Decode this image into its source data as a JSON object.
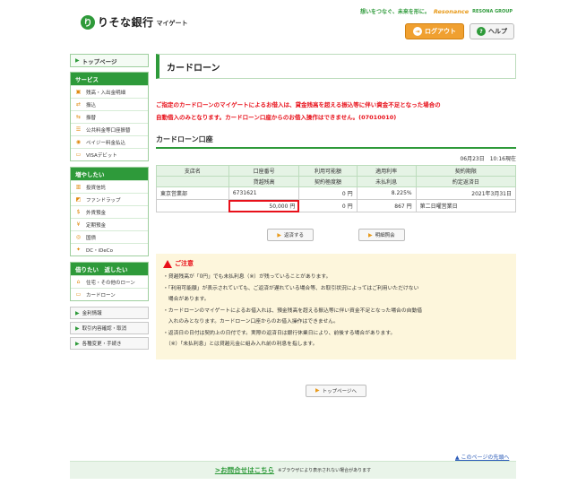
{
  "header": {
    "logo_mark": "り",
    "logo_text": "りそな銀行",
    "logo_sub": "マイゲート",
    "tagline": "想いをつなぐ、未来を形に。",
    "tagline_brand": "Resonance",
    "group": "RESONA GROUP",
    "logout_label": "ログアウト",
    "help_label": "ヘルプ"
  },
  "sidebar": {
    "top_page": "トップページ",
    "service": {
      "title": "サービス",
      "items": [
        "残高・入出金明細",
        "振込",
        "振替",
        "公共料金等口座振替",
        "ペイジー料金払込",
        "VISAデビット"
      ]
    },
    "increase": {
      "title": "増やしたい",
      "items": [
        "投資信託",
        "ファンドラップ",
        "外貨預金",
        "定期預金",
        "国債",
        "DC・iDeCo"
      ]
    },
    "borrow": {
      "title": "借りたい　返したい",
      "items": [
        "住宅・その他のローン",
        "カードローン"
      ]
    },
    "links": [
      "金利情報",
      "取引内容確認・取消",
      "各種変更・手続き"
    ]
  },
  "main": {
    "page_title": "カードローン",
    "notice_lines": [
      "ご指定のカードローンのマイゲートによるお借入は、貸金残高を超える振込等に伴い資金不足となった場合の",
      "自動借入のみとなります。カードローン口座からのお借入操作はできません。(07010010)"
    ],
    "section_title": "カードローン口座",
    "timestamp": "06月23日　10:16現在",
    "table": {
      "headers_row1": [
        "支店名",
        "口座番号",
        "利用可能額",
        "適用利率",
        "契約期限"
      ],
      "headers_row2": [
        "貸越残高",
        "契約極度額",
        "未払利息",
        "約定返済日"
      ],
      "row1": [
        "東京営業部",
        "6731621",
        "0 円",
        "8.225%",
        "2021年3月31日"
      ],
      "row2": [
        "50,000 円",
        "0 円",
        "867 円",
        "第二日曜営業日"
      ]
    },
    "repay_button": "返済する",
    "statement_button": "明細照会",
    "caution": {
      "title": "ご注意",
      "lines": [
        "・貸越残高が「0円」でも未払利息（※）が残っていることがあります。",
        "・「利用可能額」が表示されていても、ご返済が遅れている場合等、お取引状況によってはご利用いただけない",
        "　場合があります。",
        "・カードローンのマイゲートによるお借入れは、預金残高を超える振込等に伴い資金不足となった場合の自動借",
        "　入れのみとなります。カードローン口座からのお借入操作はできません。",
        "・返済日の日付は契約上の日付です。実際の返済日は銀行休業日により、前後する場合があります。",
        "　（※）「未払利息」とは貸越元金に組み入れ前の利息を指します。"
      ]
    },
    "top_page_button": "トップページへ"
  },
  "footer": {
    "page_top": "▲ このページの先頭へ",
    "inquiry": ">お問合せはこちら",
    "inquiry_note": "※ブラウザにより表示されない場合があります"
  }
}
